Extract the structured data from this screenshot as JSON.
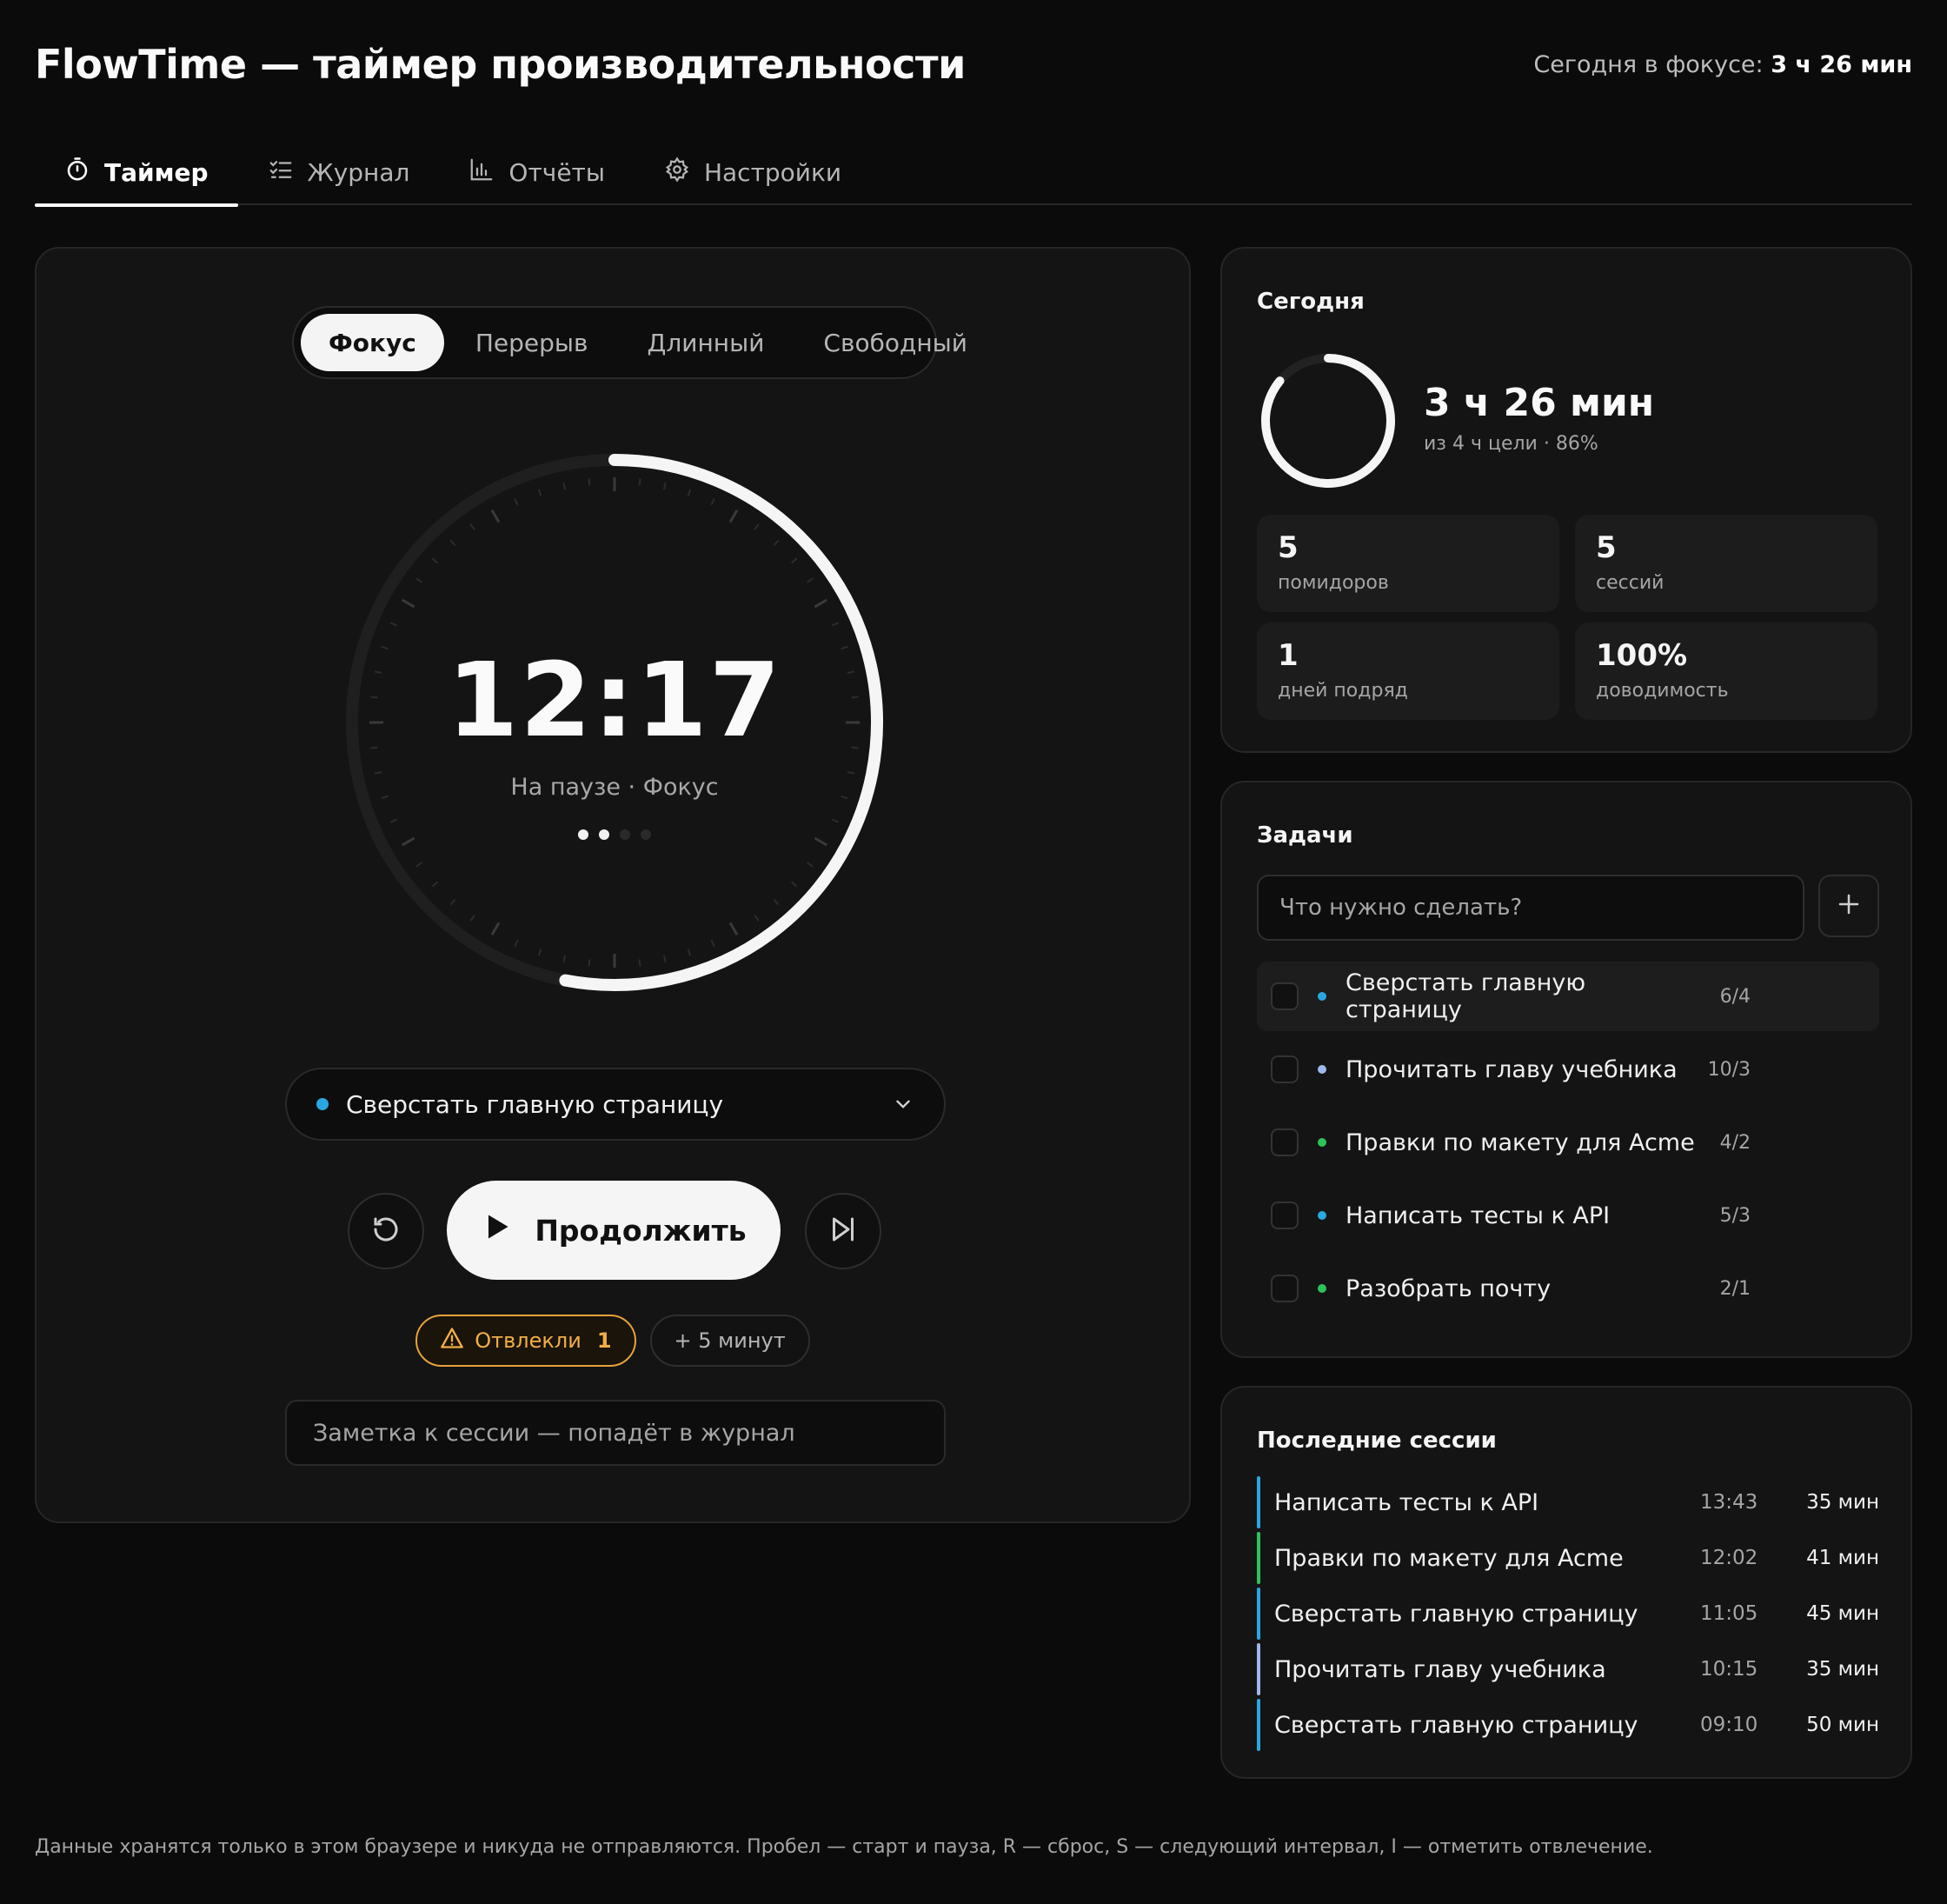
{
  "header": {
    "title": "FlowTime — таймер производительности",
    "focus_label": "Сегодня в фокусе:",
    "focus_value": "3 ч 26 мин"
  },
  "tabs": [
    {
      "label": "Таймер",
      "icon": "stopwatch-icon",
      "active": true
    },
    {
      "label": "Журнал",
      "icon": "checklist-icon",
      "active": false
    },
    {
      "label": "Отчёты",
      "icon": "bar-chart-icon",
      "active": false
    },
    {
      "label": "Настройки",
      "icon": "gear-icon",
      "active": false
    }
  ],
  "timer": {
    "modes": [
      "Фокус",
      "Перерыв",
      "Длинный",
      "Свободный"
    ],
    "active_mode": "Фокус",
    "time": "12:17",
    "status": "На паузе · Фокус",
    "progress": 0.53,
    "cycle_dots_total": 4,
    "cycle_dots_done": 2,
    "selected_task": "Сверстать главную страницу",
    "selected_task_color": "#2aa7e0",
    "continue_label": "Продолжить",
    "distracted_label": "Отвлекли",
    "distracted_count": "1",
    "add_minutes_label": "+ 5 минут",
    "note_placeholder": "Заметка к сессии — попадёт в журнал"
  },
  "today": {
    "title": "Сегодня",
    "total": "3 ч 26 мин",
    "goal_text": "из 4 ч цели · 86%",
    "goal_progress": 0.86,
    "stats": [
      {
        "value": "5",
        "label": "помидоров"
      },
      {
        "value": "5",
        "label": "сессий"
      },
      {
        "value": "1",
        "label": "дней подряд"
      },
      {
        "value": "100%",
        "label": "доводимость"
      }
    ]
  },
  "tasks": {
    "title": "Задачи",
    "input_placeholder": "Что нужно сделать?",
    "items": [
      {
        "name": "Сверстать главную страницу",
        "count": "6/4",
        "color": "#2aa7e0",
        "selected": true
      },
      {
        "name": "Прочитать главу учебника",
        "count": "10/3",
        "color": "#9db8ea",
        "selected": false
      },
      {
        "name": "Правки по макету для Acme",
        "count": "4/2",
        "color": "#2fc25b",
        "selected": false
      },
      {
        "name": "Написать тесты к API",
        "count": "5/3",
        "color": "#2aa7e0",
        "selected": false
      },
      {
        "name": "Разобрать почту",
        "count": "2/1",
        "color": "#2fc25b",
        "selected": false
      }
    ]
  },
  "sessions": {
    "title": "Последние сессии",
    "items": [
      {
        "name": "Написать тесты к API",
        "time": "13:43",
        "duration": "35 мин",
        "color": "#2aa7e0"
      },
      {
        "name": "Правки по макету для Acme",
        "time": "12:02",
        "duration": "41 мин",
        "color": "#2fc25b"
      },
      {
        "name": "Сверстать главную страницу",
        "time": "11:05",
        "duration": "45 мин",
        "color": "#2aa7e0"
      },
      {
        "name": "Прочитать главу учебника",
        "time": "10:15",
        "duration": "35 мин",
        "color": "#9db8ea"
      },
      {
        "name": "Сверстать главную страницу",
        "time": "09:10",
        "duration": "50 мин",
        "color": "#2aa7e0"
      }
    ]
  },
  "footer": {
    "text": "Данные хранятся только в этом браузере и никуда не отправляются. Пробел — старт и пауза, R — сброс, S — следующий интервал, I — отметить отвлечение."
  }
}
